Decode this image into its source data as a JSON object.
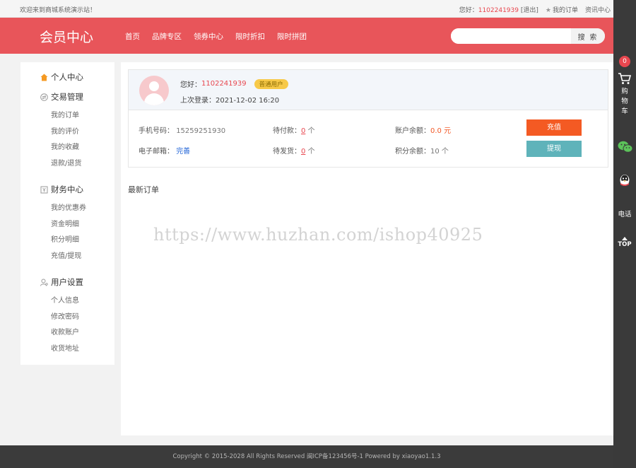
{
  "topbar": {
    "welcome": "欢迎来到商城系统演示站！",
    "greeting": "您好：",
    "user_id": "1102241939",
    "logout": "[退出]",
    "my_orders": "我的订单",
    "news_center": "资讯中心"
  },
  "header": {
    "title": "会员中心",
    "nav": [
      "首页",
      "品牌专区",
      "领券中心",
      "限时折扣",
      "限时拼团"
    ],
    "search_placeholder": "",
    "search_button": "搜 索",
    "bg_color": "#e8555a"
  },
  "sidebar": {
    "groups": [
      {
        "title": "个人中心",
        "icon": "home-icon",
        "items": []
      },
      {
        "title": "交易管理",
        "icon": "exchange-icon",
        "items": [
          "我的订单",
          "我的评价",
          "我的收藏",
          "退款/退货"
        ]
      },
      {
        "title": "财务中心",
        "icon": "wallet-icon",
        "items": [
          "我的优惠券",
          "资金明细",
          "积分明细",
          "充值/提现"
        ]
      },
      {
        "title": "用户设置",
        "icon": "user-settings-icon",
        "items": [
          "个人信息",
          "修改密码",
          "收款账户",
          "收货地址"
        ]
      }
    ]
  },
  "user": {
    "greeting": "您好：",
    "user_id": "1102241939",
    "level_badge": "普通用户",
    "last_login_label": "上次登录：",
    "last_login": "2021-12-02 16:20",
    "phone_label": "手机号码：",
    "phone": "15259251930",
    "email_label": "电子邮箱：",
    "email_action": "完善",
    "pending_pay_label": "待付款：",
    "pending_pay_count": "0",
    "pending_ship_label": "待发货：",
    "pending_ship_count": "0",
    "unit_ge": "个",
    "balance_label": "账户余额：",
    "balance": "0.0",
    "balance_unit": "元",
    "points_label": "积分余额：",
    "points": "10",
    "recharge_button": "充值",
    "withdraw_button": "提现"
  },
  "latest_orders_title": "最新订单",
  "watermark": "https://www.huzhan.com/ishop40925",
  "rail": {
    "cart_count": "0",
    "cart_label": "购物车",
    "phone_label": "电话",
    "top_label": "TOP"
  },
  "footer": {
    "text": "Copyright © 2015-2028 All Rights Reserved 闽ICP备123456号-1   Powered by xiaoyao1.1.3"
  }
}
